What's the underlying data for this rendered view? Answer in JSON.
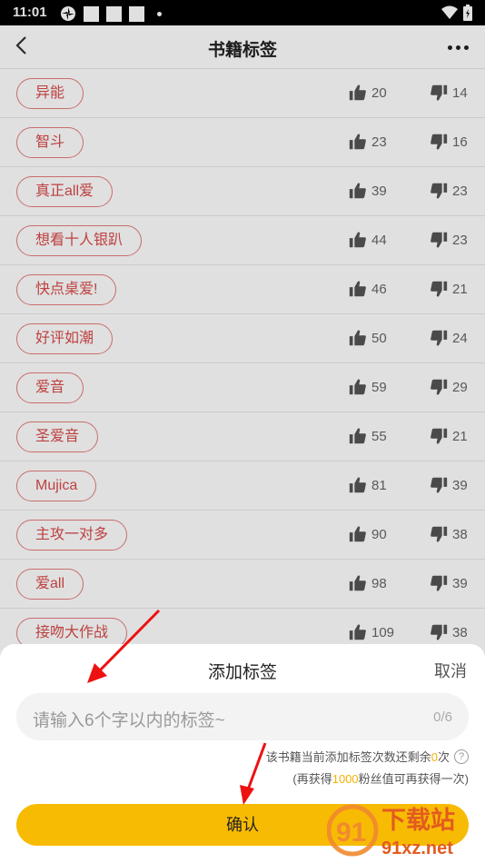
{
  "status": {
    "time": "11:01"
  },
  "header": {
    "title": "书籍标签"
  },
  "tags": [
    {
      "label": "异能",
      "likes": "20",
      "dislikes": "14"
    },
    {
      "label": "智斗",
      "likes": "23",
      "dislikes": "16"
    },
    {
      "label": "真正all爱",
      "likes": "39",
      "dislikes": "23"
    },
    {
      "label": "想看十人银趴",
      "likes": "44",
      "dislikes": "23"
    },
    {
      "label": "快点桌爱!",
      "likes": "46",
      "dislikes": "21"
    },
    {
      "label": "好评如潮",
      "likes": "50",
      "dislikes": "24"
    },
    {
      "label": "爱音",
      "likes": "59",
      "dislikes": "29"
    },
    {
      "label": "圣爱音",
      "likes": "55",
      "dislikes": "21"
    },
    {
      "label": "Mujica",
      "likes": "81",
      "dislikes": "39"
    },
    {
      "label": "主攻一对多",
      "likes": "90",
      "dislikes": "38"
    },
    {
      "label": "爱all",
      "likes": "98",
      "dislikes": "39"
    },
    {
      "label": "接吻大作战",
      "likes": "109",
      "dislikes": "38"
    }
  ],
  "sheet": {
    "title": "添加标签",
    "cancel": "取消",
    "placeholder": "请输入6个字以内的标签~",
    "counter": "0/6",
    "remain_prefix": "该书籍当前添加标签次数还剩余",
    "remain_count": "0",
    "remain_suffix": "次",
    "gain_prefix": "(再获得",
    "gain_amount": "1000",
    "gain_suffix": "粉丝值可再获得一次)",
    "confirm": "确认"
  },
  "watermark": {
    "brand": "下载站",
    "domain": "91xz.net",
    "logo": "91"
  },
  "colors": {
    "accent": "#f8bb04",
    "tag": "#d94b4b"
  }
}
